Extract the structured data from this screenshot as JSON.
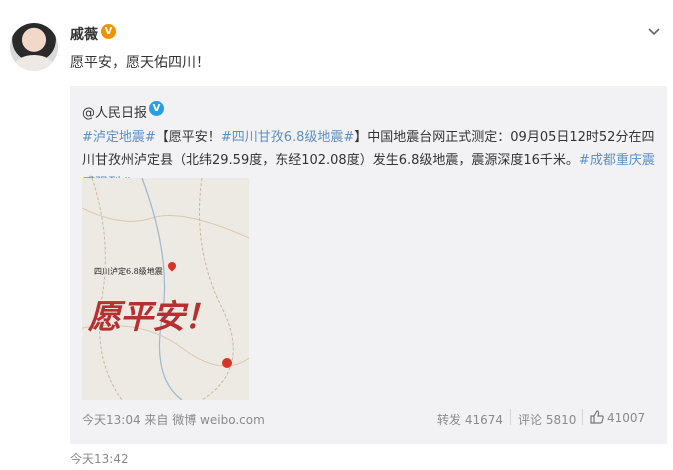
{
  "post": {
    "author": "戚薇",
    "verified_badge": "V",
    "text": "愿平安，愿天佑四川！",
    "time": "今天13:42"
  },
  "repost": {
    "author": "@人民日报",
    "verified_badge": "V",
    "tag1": "#泸定地震#",
    "text1": "【愿平安！",
    "tag2": "#四川甘孜6.8级地震#",
    "text2": "】中国地震台网正式测定：09月05日12时52分在四川甘孜州泸定县（北纬29.59度，东经102.08度）发生6.8级地震，震源深度16千米。",
    "tag3": "#成都重庆震感强烈#",
    "image": {
      "caption": "四川泸定6.8级地震",
      "headline": "愿平安！"
    },
    "time": "今天13:04",
    "source": "来自 微博 weibo.com",
    "forward": "转发 41674",
    "comment": "评论 5810",
    "likes": "41007"
  },
  "icons": {
    "chevron": "chevron-down-icon",
    "like": "thumbs-up-icon",
    "pin": "map-pin-icon"
  },
  "colors": {
    "link": "#5d8ec4",
    "repost_bg": "#f2f2f5",
    "headline_red": "#b5302f"
  }
}
